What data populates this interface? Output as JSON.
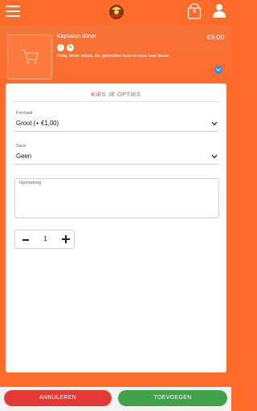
{
  "header": {
    "cart_count": "0"
  },
  "product": {
    "name": "Kapsalon döner",
    "price": "€9,00",
    "description": "Patat, döner kebab, sla, gesmolten kaas en saus naar keuze",
    "diet_icons": [
      "halal-icon",
      "spicy-icon"
    ]
  },
  "modal": {
    "title": "KIES JE OPTIES",
    "format": {
      "label": "Formaat",
      "value": "Groot (+ €1,00)"
    },
    "sauce": {
      "label": "Saus",
      "value": "Geen"
    },
    "remark": {
      "label": "Opmerking"
    },
    "quantity": "1"
  },
  "actions": {
    "cancel": "ANNULEREN",
    "add": "TOEVOEGEN"
  },
  "colors": {
    "brand": "#ff6b2b",
    "accent_title": "#e8532a",
    "cancel": "#e53935",
    "add": "#3fa24a"
  }
}
